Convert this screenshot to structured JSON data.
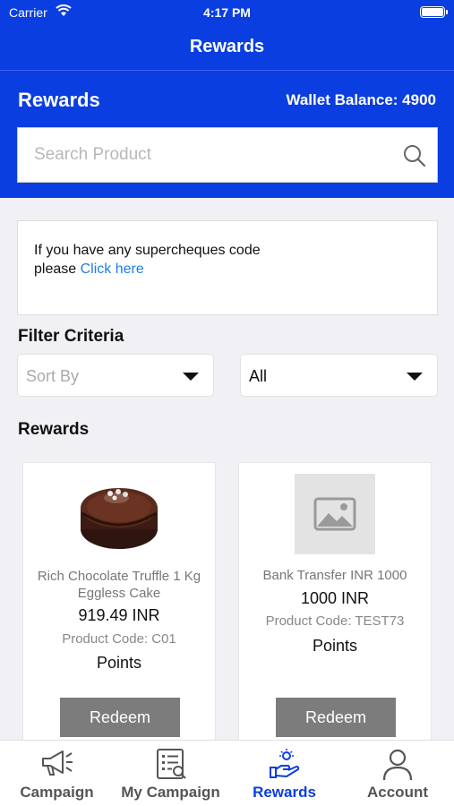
{
  "status_bar": {
    "carrier": "Carrier",
    "time": "4:17 PM"
  },
  "nav": {
    "title": "Rewards"
  },
  "header": {
    "title": "Rewards",
    "wallet_label": "Wallet Balance: 4900",
    "search_placeholder": "Search Product"
  },
  "code_box": {
    "line1": "If you have any supercheques code",
    "line2": "please ",
    "link": "Click here"
  },
  "filter": {
    "title": "Filter Criteria",
    "sort_by": "Sort By",
    "category": "All"
  },
  "rewards_section": {
    "title": "Rewards"
  },
  "products": [
    {
      "name": "Rich Chocolate Truffle 1 Kg Eggless Cake",
      "price": "919.49 INR",
      "code": "Product Code: C01",
      "points": "Points",
      "redeem": "Redeem",
      "image_icon": "cake-image"
    },
    {
      "name": "Bank Transfer INR 1000",
      "price": "1000 INR",
      "code": "Product Code: TEST73",
      "points": "Points",
      "redeem": "Redeem",
      "image_icon": "image-placeholder-icon"
    }
  ],
  "tabs": [
    {
      "label": "Campaign",
      "icon": "megaphone-icon",
      "active": false
    },
    {
      "label": "My Campaign",
      "icon": "document-search-icon",
      "active": false
    },
    {
      "label": "Rewards",
      "icon": "rewards-hand-icon",
      "active": true
    },
    {
      "label": "Account",
      "icon": "user-icon",
      "active": false
    }
  ],
  "colors": {
    "primary": "#0a3ee0",
    "link": "#1a7fe6",
    "button": "#7c7c7c"
  }
}
